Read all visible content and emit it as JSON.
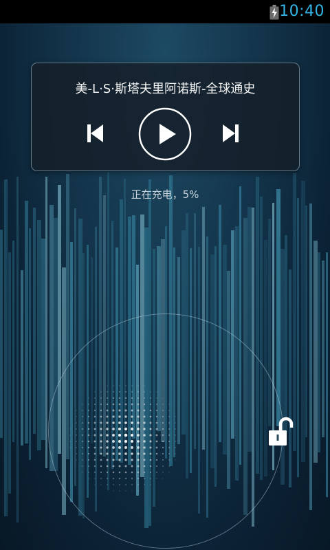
{
  "status_bar": {
    "time": "10:40",
    "battery_icon": "battery-charging-icon",
    "clock_color": "#33b5e5"
  },
  "music_widget": {
    "track_title": "美-L·S·斯塔夫里阿诺斯-全球通史",
    "prev_icon": "skip-previous-icon",
    "play_icon": "play-icon",
    "next_icon": "skip-next-icon"
  },
  "charging_status": "正在充电，5%",
  "unlock": {
    "target_icon": "unlock-padlock-icon",
    "handle_icon": "dotted-handle-icon"
  }
}
